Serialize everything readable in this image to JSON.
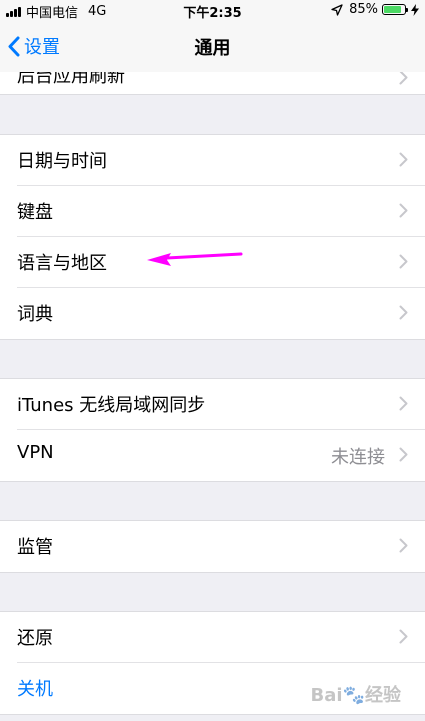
{
  "status_bar": {
    "carrier": "中国电信",
    "network": "4G",
    "time": "下午2:35",
    "battery": "85%",
    "battery_level": 0.85,
    "battery_color": "#4cd964"
  },
  "nav": {
    "back_label": "设置",
    "title": "通用",
    "accent": "#007aff"
  },
  "partial_row": {
    "label": "后台应用刷新"
  },
  "groups": [
    {
      "rows": [
        {
          "label": "日期与时间"
        },
        {
          "label": "键盘"
        },
        {
          "label": "语言与地区"
        },
        {
          "label": "词典"
        }
      ]
    },
    {
      "rows": [
        {
          "label": "iTunes 无线局域网同步"
        },
        {
          "label": "VPN",
          "value": "未连接"
        }
      ]
    },
    {
      "rows": [
        {
          "label": "监管"
        }
      ]
    },
    {
      "rows": [
        {
          "label": "还原"
        },
        {
          "label": "关机"
        }
      ]
    }
  ],
  "annotation": {
    "color": "#ff00ff"
  },
  "watermark": "Baidu经验"
}
